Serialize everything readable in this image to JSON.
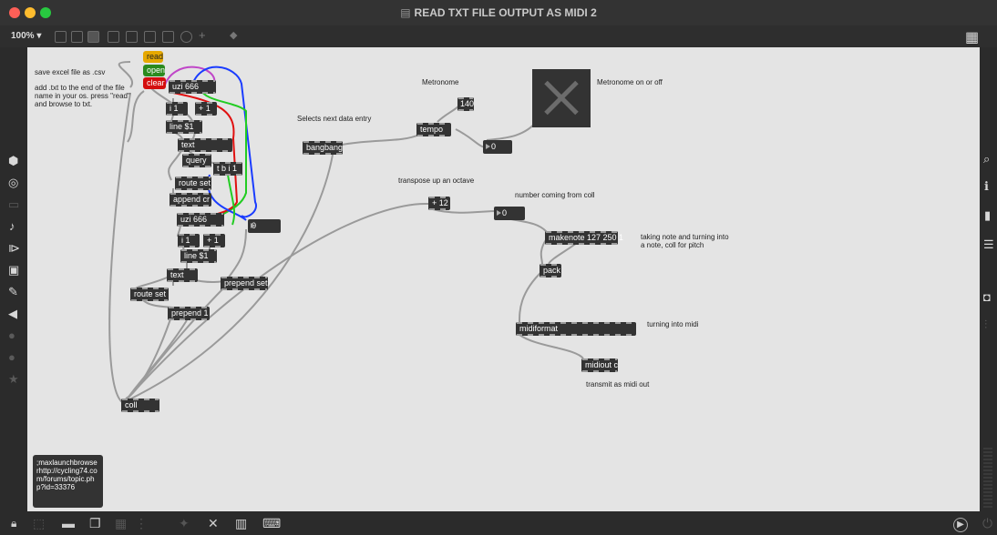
{
  "window": {
    "title": "READ TXT FILE OUTPUT AS MIDI 2",
    "zoom": "100% ▾",
    "colors": {
      "close": "#fe5f57",
      "minimize": "#febc2e",
      "maximize": "#28c840"
    }
  },
  "toolbar": {
    "icons": [
      "presentation-mode-icon",
      "patching-mode-icon",
      "comment-icon",
      "button-icon",
      "toggle-icon",
      "number-icon",
      "slider-icon",
      "dial-icon",
      "add-object-icon",
      "fill-icon"
    ],
    "grid_glyph": "▦"
  },
  "left_sidebar": {
    "icons": [
      {
        "name": "package-icon",
        "glyph": "⬢"
      },
      {
        "name": "target-icon",
        "glyph": "◎"
      },
      {
        "name": "rect-icon",
        "glyph": "▭"
      },
      {
        "name": "music-icon",
        "glyph": "♪"
      },
      {
        "name": "bracket-icon",
        "glyph": "⧐"
      },
      {
        "name": "image-icon",
        "glyph": "▣"
      },
      {
        "name": "clip-icon",
        "glyph": "✎"
      },
      {
        "name": "back-icon",
        "glyph": "◀"
      },
      {
        "name": "circle-icon",
        "glyph": "●"
      },
      {
        "name": "circle2-icon",
        "glyph": "●"
      },
      {
        "name": "star-icon",
        "glyph": "★"
      }
    ]
  },
  "right_sidebar": {
    "icons": [
      {
        "name": "search-icon",
        "glyph": "⌕"
      },
      {
        "name": "info-icon",
        "glyph": "ℹ"
      },
      {
        "name": "book-icon",
        "glyph": "▮"
      },
      {
        "name": "list-icon",
        "glyph": "☰"
      },
      {
        "name": "camera-icon",
        "glyph": "◘"
      },
      {
        "name": "mixer-icon",
        "glyph": "⫶"
      }
    ]
  },
  "bottombar": {
    "icons": [
      {
        "name": "lock-icon",
        "glyph": "🔒"
      },
      {
        "name": "select-icon",
        "glyph": "⬚"
      },
      {
        "name": "presentation-icon",
        "glyph": "▬"
      },
      {
        "name": "windows-icon",
        "glyph": "❐"
      },
      {
        "name": "grid-icon",
        "glyph": "▦"
      },
      {
        "name": "align-icon",
        "glyph": "⋮"
      },
      {
        "name": "debug-icon",
        "glyph": "✦"
      },
      {
        "name": "wrench-icon",
        "glyph": "✕"
      },
      {
        "name": "piano-icon",
        "glyph": "▥"
      },
      {
        "name": "keyboard-icon",
        "glyph": "⌨"
      },
      {
        "name": "play-icon",
        "glyph": "▶"
      },
      {
        "name": "power-icon",
        "glyph": "⏻"
      }
    ]
  },
  "patch": {
    "messages": {
      "read": "read",
      "open": "open",
      "clear": "clear",
      "launch": ";\rmax\rlaunchbrowser\rhttp://cycling74.com/forums/topic.php?id=33376"
    },
    "objects": {
      "uzi1": "uzi 666",
      "i1": "i 1",
      "plus1": "+ 1",
      "line1": "line $1",
      "text1": "text",
      "query": "query",
      "tbi": "t b i 1",
      "routeset1": "route set",
      "appendcr": "append cr",
      "uzi2": "uzi 666",
      "i2": "i 1",
      "plus2": "+ 1",
      "line2": "line $1",
      "text2": "text",
      "routeset2": "route set",
      "prependset": "prepend set",
      "prepend1": "prepend 1",
      "coll": "coll",
      "bangbang": "bangbang",
      "tempo": "tempo",
      "plus12": "+ 12",
      "makenote": "makenote 127 250 1",
      "pack": "pack",
      "midiformat": "midiformat",
      "midiout": "midiout c"
    },
    "numbers": {
      "num_zero_left": "0",
      "num_tempo": "140",
      "num_tempo_out": "0",
      "num_coll": "0"
    },
    "comments": {
      "csv": "save excel file as .csv",
      "instructions": "add .txt to the end of the file name in your os. press \"read\" and browse to txt.",
      "metronome": "Metronome",
      "metronome_onoff": "Metronome on or off",
      "selects": "Selects next data entry",
      "transpose": "transpose up an octave",
      "number_coll": "number coming from coll",
      "taking_note": "taking note and turning into a note, coll for pitch",
      "midi": "turning into midi",
      "transmit": "transmit as midi out"
    },
    "colors": {
      "read_msg": "#e6a800",
      "open_msg": "#2b8a1e",
      "clear_msg": "#d40e0e",
      "patch_cord": "#9a9a9a",
      "cord_blue": "#1a3cff",
      "cord_red": "#e01010",
      "cord_green": "#22cc22",
      "cord_purple": "#c046c8"
    }
  }
}
